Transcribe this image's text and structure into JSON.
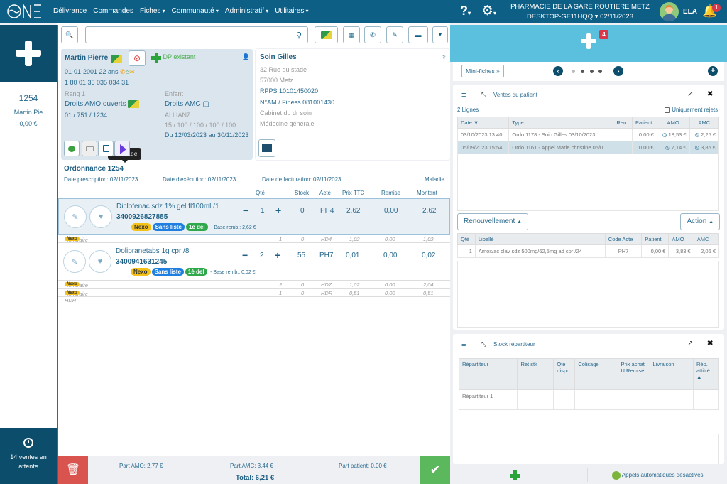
{
  "topbar": {
    "logo": "ONE",
    "nav": [
      {
        "label": "Délivrance",
        "dropdown": false
      },
      {
        "label": "Commandes",
        "dropdown": false
      },
      {
        "label": "Fiches",
        "dropdown": true
      },
      {
        "label": "Communauté",
        "dropdown": true
      },
      {
        "label": "Administratif",
        "dropdown": true
      },
      {
        "label": "Utilitaires",
        "dropdown": true
      }
    ],
    "help": "?",
    "pharmacy_name": "PHARMACIE DE LA GARE ROUTIERE METZ",
    "workstation": "DESKTOP-GF11HQQ",
    "date": "02/11/2023",
    "user": "ELA",
    "notifications": "1"
  },
  "left": {
    "current_sale": {
      "number": "1254",
      "name": "Martin Pie",
      "amount": "0,00 €"
    },
    "pending": {
      "line1": "14 ventes en",
      "line2": "attente"
    }
  },
  "patient": {
    "name": "Martin Pierre",
    "dp": "DP existant",
    "birth": "01-01-2001 22 ans",
    "nir": "1 80 01 35 035 034 31",
    "rang": "Rang 1",
    "enfant": "Enfant",
    "amo": "Droits AMO ouverts",
    "amo_code": "01 / 751 / 1234",
    "amc": "Droits AMC",
    "amc_org": "ALLIANZ",
    "amc_rates": "15 / 100 / 100 / 100 / 100",
    "amc_period": "Du 12/03/2023 au 30/11/2023",
    "tooltip": "Bimedoc"
  },
  "prescriber": {
    "name": "Soin Gilles",
    "address1": "32 Rue du stade",
    "address2": "57000 Metz",
    "rpps": "RPPS 10101450020",
    "finess": "N°AM / Finess 081001430",
    "cabinet": "Cabinet du dr soin",
    "specialty": "Médecine générale"
  },
  "ordonnance": {
    "title": "Ordonnance 1254",
    "date_prescription": "Date prescription: 02/11/2023",
    "date_execution": "Date d'exécution: 02/11/2023",
    "date_facturation": "Date de facturation: 02/11/2023",
    "regime": "Maladie",
    "headers": {
      "qte": "Qté",
      "stock": "Stock",
      "acte": "Acte",
      "prix": "Prix TTC",
      "remise": "Remise",
      "montant": "Montant"
    },
    "items": [
      {
        "name": "Diclofenac sdz 1% gel fl100ml /1",
        "cip": "3400926827885",
        "qty": "1",
        "stock": "0",
        "acte": "PH4",
        "prix": "2,62",
        "remise": "0,00",
        "montant": "2,62",
        "tags": [
          "Nexo",
          "Sans liste",
          "1è del"
        ],
        "base": "- Base remb.: 2,62 €",
        "honoraires": [
          {
            "label": "Honoraire HD4",
            "tag": "Nexo",
            "qty": "1",
            "stock": "0",
            "acte": "HD4",
            "prix": "1,02",
            "remise": "0,00",
            "montant": "1,02"
          }
        ]
      },
      {
        "name": "Dolipranetabs 1g cpr /8",
        "cip": "3400941631245",
        "qty": "2",
        "stock": "55",
        "acte": "PH7",
        "prix": "0,01",
        "remise": "0,00",
        "montant": "0,02",
        "tags": [
          "Nexo",
          "Sans liste",
          "1è del"
        ],
        "base": "- Base remb.: 0,02 €",
        "honoraires": [
          {
            "label": "Honoraire HD7",
            "tag": "Nexo",
            "qty": "2",
            "stock": "0",
            "acte": "HD7",
            "prix": "1,02",
            "remise": "0,00",
            "montant": "2,04"
          },
          {
            "label": "Honoraire HDR",
            "tag": "Nexo",
            "qty": "1",
            "stock": "0",
            "acte": "HDR",
            "prix": "0,51",
            "remise": "0,00",
            "montant": "0,51"
          }
        ]
      }
    ]
  },
  "footer": {
    "amo": "Part AMO: 2,77 €",
    "amc": "Part AMC: 3,44 €",
    "patient": "Part patient: 0,00 €",
    "total": "Total: 6,21 €"
  },
  "right": {
    "badge": "4",
    "mini_fiches": "Mini-fiches »",
    "ventes": {
      "title": "Ventes du patient",
      "count": "2 Lignes",
      "filter": "Uniquement rejets",
      "headers": [
        "Date ▼",
        "Type",
        "Ren.",
        "Patient",
        "AMO",
        "AMC"
      ],
      "rows": [
        [
          "03/10/2023 13:40",
          "Ordo 1178 - Soin Gilles 03/10/2023",
          "",
          "0,00 €",
          "18,53 €",
          "2,25 €"
        ],
        [
          "05/09/2023 15:54",
          "Ordo 1161 - Appel Marie christine 05/0",
          "",
          "0,00 €",
          "7,14 €",
          "3,85 €"
        ]
      ],
      "renouvellement": "Renouvellement",
      "action": "Action",
      "detail_headers": [
        "Qté",
        "Libellé",
        "Code Acte",
        "Patient",
        "AMO",
        "AMC"
      ],
      "detail_rows": [
        [
          "1",
          "Amox/ac clav sdz 500mg/62,5mg ad cpr /24",
          "PH7",
          "0,00 €",
          "3,83 €",
          "2,06 €"
        ]
      ]
    },
    "stock": {
      "title": "Stock répartiteur",
      "headers": [
        "Répartiteur",
        "Ret stk",
        "Qté dispo",
        "Colisage",
        "Prix achat U Remisé",
        "Livraison",
        "Rép. attitré ▲"
      ],
      "rows": [
        [
          "Répartiteur 1",
          "",
          "",
          "",
          "",
          "",
          ""
        ]
      ]
    },
    "auto_calls": "Appels automatiques désactivés"
  },
  "colors": {
    "primary": "#0e5f86",
    "dark": "#0c4d6b",
    "light_blue": "#5bbfde",
    "danger": "#d9534f",
    "success": "#5cb85c",
    "nexo": "#f4c118",
    "sans_liste": "#1f7fe0",
    "del": "#2ea84a"
  }
}
